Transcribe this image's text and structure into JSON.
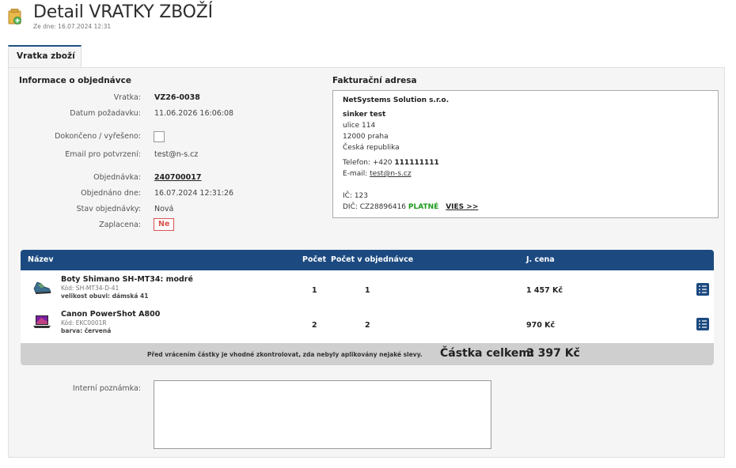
{
  "header": {
    "title": "Detail VRATKY ZBOŽÍ",
    "subtitle": "Ze dne: 16.07.2024 12:31"
  },
  "tabs": [
    {
      "label": "Vratka zboží"
    }
  ],
  "order_info": {
    "section_title": "Informace o objednávce",
    "fields": {
      "vratka": {
        "label": "Vratka:",
        "value": "VZ26-0038"
      },
      "datum_pozadavku": {
        "label": "Datum požadavku:",
        "value": "11.06.2026 16:06:08"
      },
      "dokonceno": {
        "label": "Dokončeno / vyřešeno:",
        "checked": false
      },
      "email": {
        "label": "Email pro potvrzení:",
        "value": "test@n-s.cz"
      },
      "objednavka": {
        "label": "Objednávka:",
        "value": "240700017"
      },
      "objednano_dne": {
        "label": "Objednáno dne:",
        "value": "16.07.2024 12:31:26"
      },
      "stav": {
        "label": "Stav objednávky:",
        "value": "Nová"
      },
      "zaplacena": {
        "label": "Zaplacena:",
        "value": "Ne"
      }
    }
  },
  "billing": {
    "section_title": "Fakturační adresa",
    "company": "NetSystems Solution s.r.o.",
    "name": "sinker test",
    "street": "ulice 114",
    "city": "12000 praha",
    "country": "Česká republika",
    "phone_label": "Telefon: +420 ",
    "phone": "111111111",
    "email_label": "E-mail: ",
    "email": "test@n-s.cz",
    "ic": "IČ: 123",
    "dic": "DIČ: CZ28896416",
    "dic_status": "PLATNÉ",
    "vies_link": "VIES >>"
  },
  "table": {
    "headers": {
      "name": "Název",
      "count": "Počet",
      "count_in_order": "Počet v objednávce",
      "unit_price": "J. cena"
    },
    "rows": [
      {
        "name": "Boty Shimano SH-MT34: modré",
        "code": "Kód: SH-MT34-D-41",
        "variant": "velikost obuvi: dámská 41",
        "count": "1",
        "count_in_order": "1",
        "unit_price": "1 457 Kč",
        "image_icon": "shoe-icon"
      },
      {
        "name": "Canon PowerShot A800",
        "code": "Kód: EKC0001R",
        "variant": "barva: červená",
        "count": "2",
        "count_in_order": "2",
        "unit_price": "970 Kč",
        "image_icon": "laptop-icon"
      }
    ],
    "footer_note": "Před vrácením částky je vhodné zkontrolovat, zda nebyly aplikovány nejaké slevy.",
    "total_label": "Částka celkem:",
    "total_value": "3 397 Kč"
  },
  "notes": {
    "label": "Interní poznámka:",
    "value": ""
  },
  "colors": {
    "header_blue": "#1c4a80",
    "valid_green": "#1b9a1b",
    "unpaid_red": "#d9534f"
  }
}
